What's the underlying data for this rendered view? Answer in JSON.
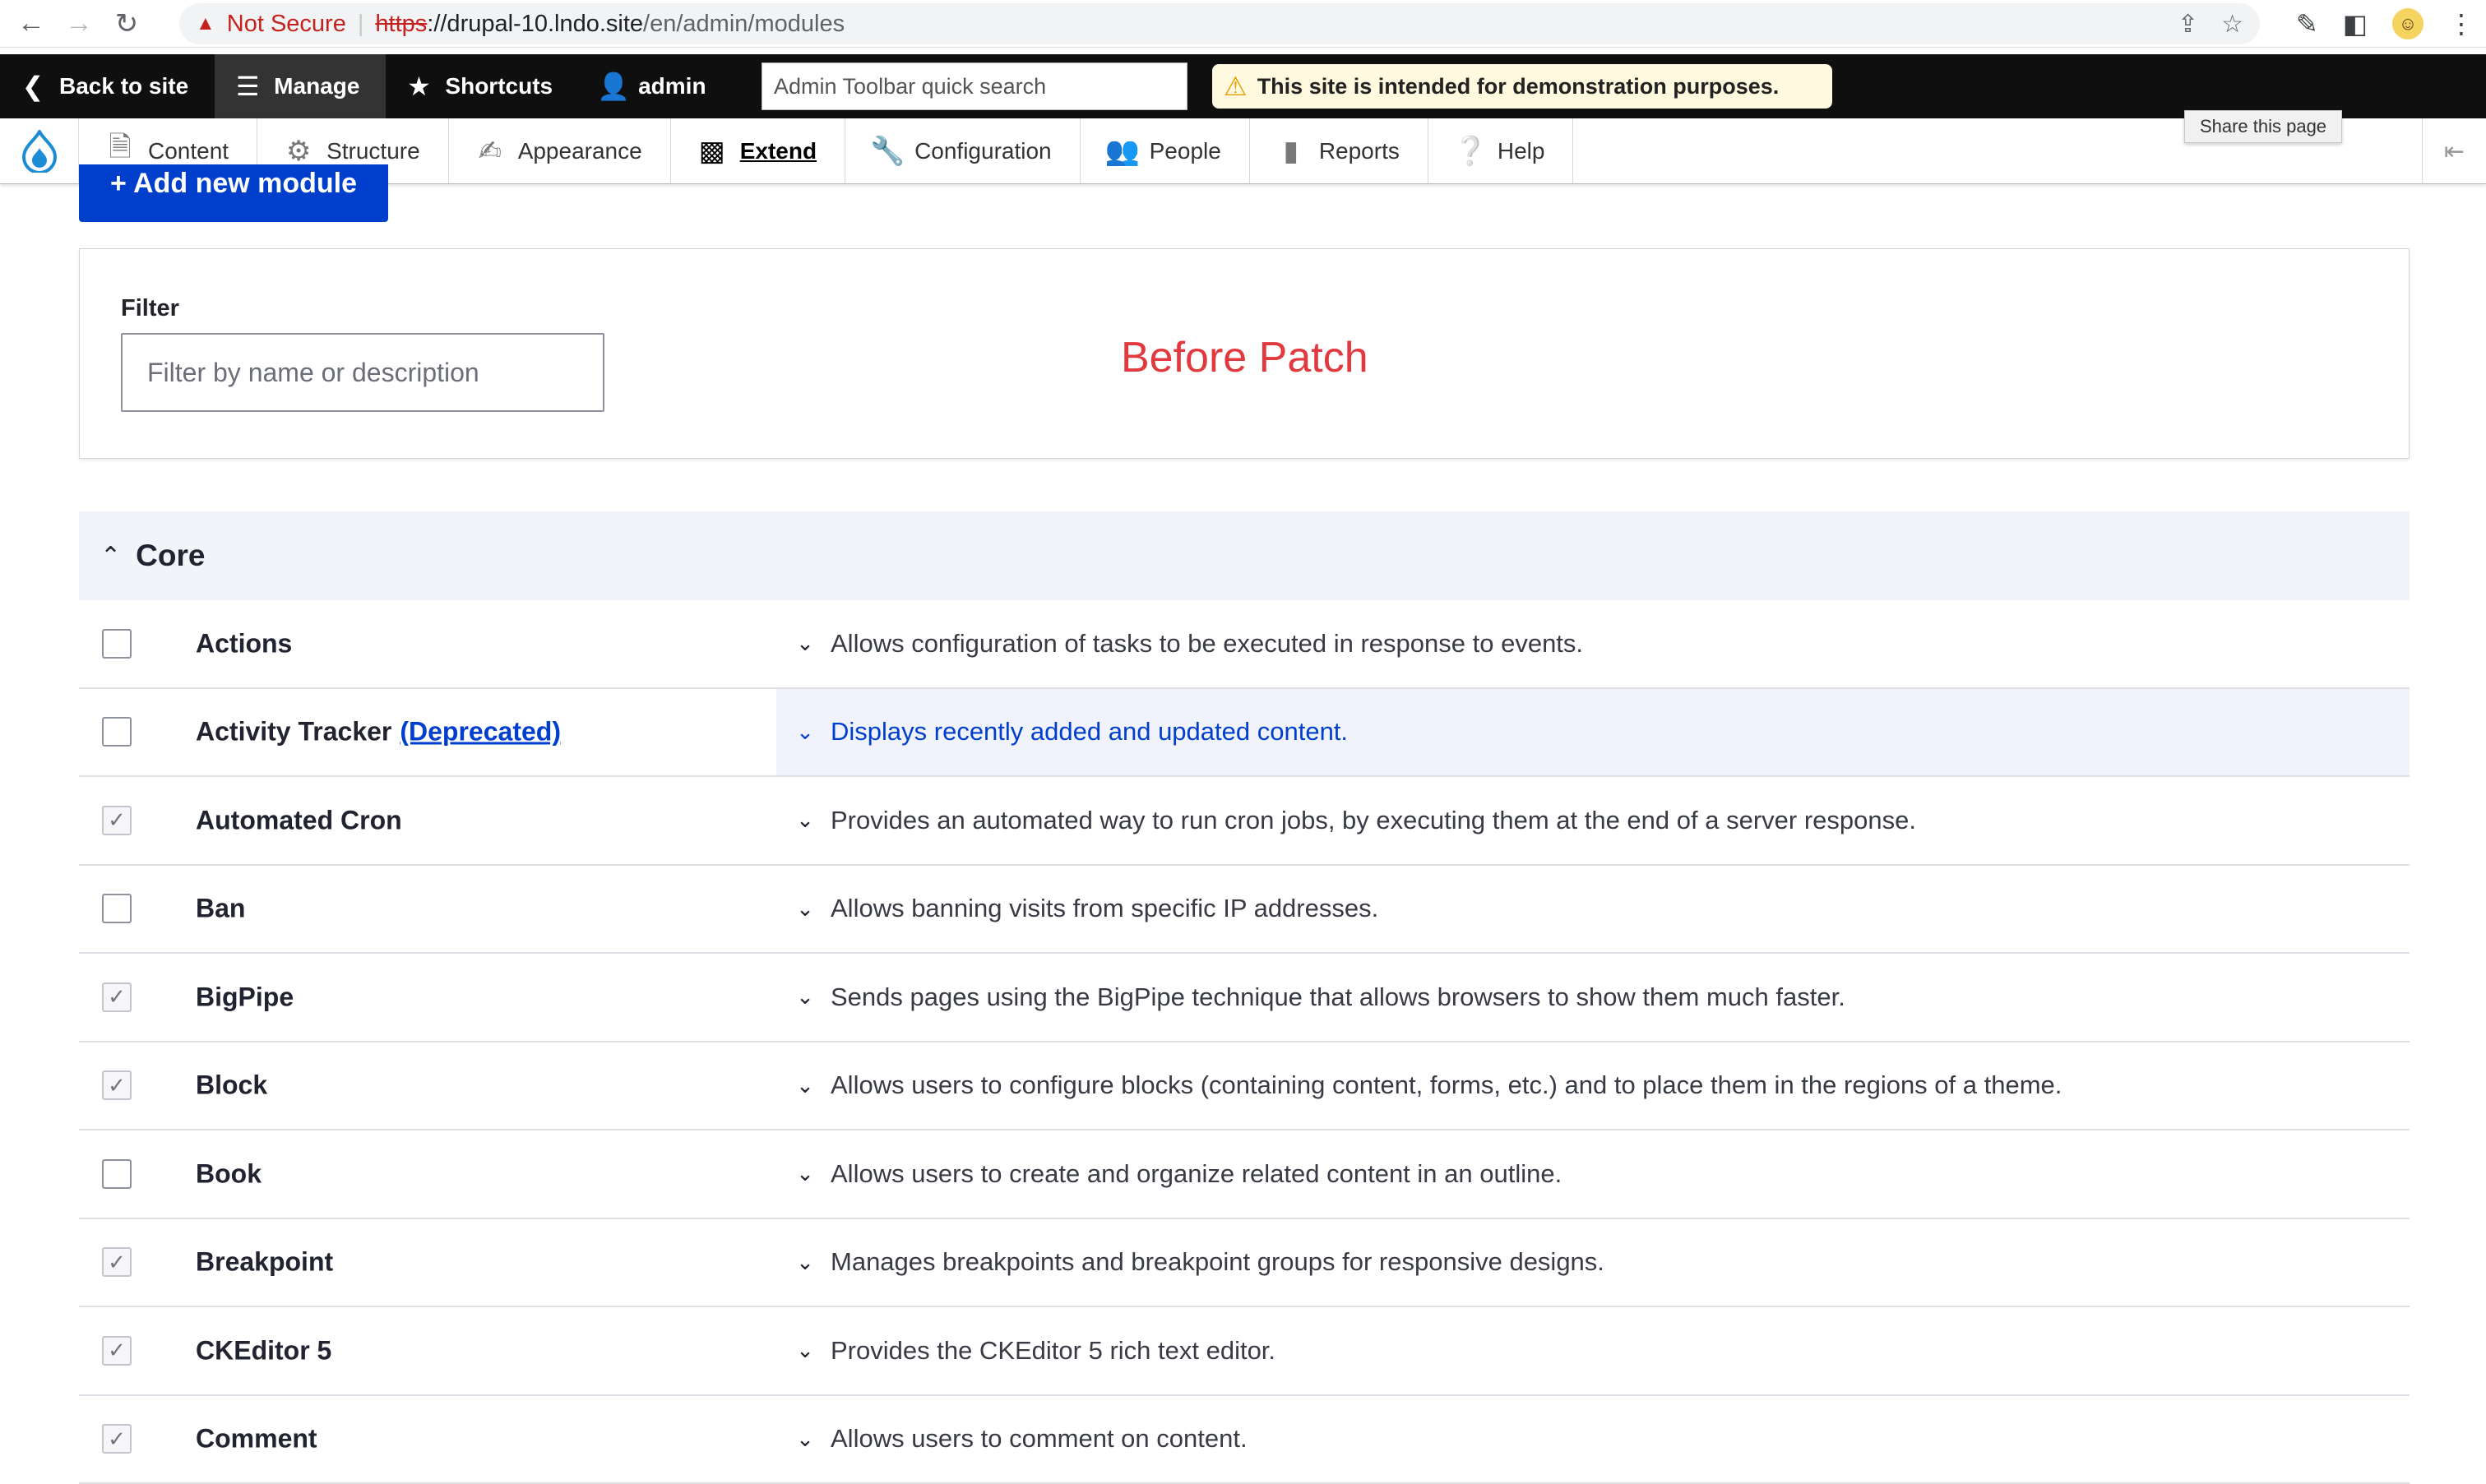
{
  "browser": {
    "security_label": "Not Secure",
    "url_scheme": "https",
    "url_rest_host": "://drupal-10.lndo.site",
    "url_path": "/en/admin/modules",
    "tooltip": "Share this page"
  },
  "toolbar": {
    "back_to_site": "Back to site",
    "manage": "Manage",
    "shortcuts": "Shortcuts",
    "user": "admin",
    "search_placeholder": "Admin Toolbar quick search",
    "demo_notice": "This site is intended for demonstration purposes."
  },
  "menu": {
    "items": [
      {
        "label": "Content",
        "icon": "file-icon"
      },
      {
        "label": "Structure",
        "icon": "sitemap-icon"
      },
      {
        "label": "Appearance",
        "icon": "paintbrush-icon"
      },
      {
        "label": "Extend",
        "icon": "puzzle-icon"
      },
      {
        "label": "Configuration",
        "icon": "wrench-icon"
      },
      {
        "label": "People",
        "icon": "people-icon"
      },
      {
        "label": "Reports",
        "icon": "bar-chart-icon"
      },
      {
        "label": "Help",
        "icon": "help-icon"
      }
    ],
    "active": "Extend"
  },
  "page": {
    "add_module_label": "+ Add new module",
    "filter_label": "Filter",
    "filter_placeholder": "Filter by name or description",
    "annotation": "Before Patch",
    "section_title": "Core"
  },
  "modules": [
    {
      "name": "Actions",
      "checked": false,
      "description": "Allows configuration of tasks to be executed in response to events."
    },
    {
      "name": "Activity Tracker",
      "extra": "(Deprecated)",
      "checked": false,
      "highlight": true,
      "description": "Displays recently added and updated content."
    },
    {
      "name": "Automated Cron",
      "checked": true,
      "description": "Provides an automated way to run cron jobs, by executing them at the end of a server response."
    },
    {
      "name": "Ban",
      "checked": false,
      "description": "Allows banning visits from specific IP addresses."
    },
    {
      "name": "BigPipe",
      "checked": true,
      "description": "Sends pages using the BigPipe technique that allows browsers to show them much faster."
    },
    {
      "name": "Block",
      "checked": true,
      "description": "Allows users to configure blocks (containing content, forms, etc.) and to place them in the regions of a theme."
    },
    {
      "name": "Book",
      "checked": false,
      "description": "Allows users to create and organize related content in an outline."
    },
    {
      "name": "Breakpoint",
      "checked": true,
      "description": "Manages breakpoints and breakpoint groups for responsive designs."
    },
    {
      "name": "CKEditor 5",
      "checked": true,
      "description": "Provides the CKEditor 5 rich text editor."
    },
    {
      "name": "Comment",
      "checked": true,
      "description": "Allows users to comment on content."
    }
  ],
  "colors": {
    "primary_blue": "#003ecc",
    "annotation_red": "#e0393e",
    "toolbar_black": "#0f0f0f"
  }
}
